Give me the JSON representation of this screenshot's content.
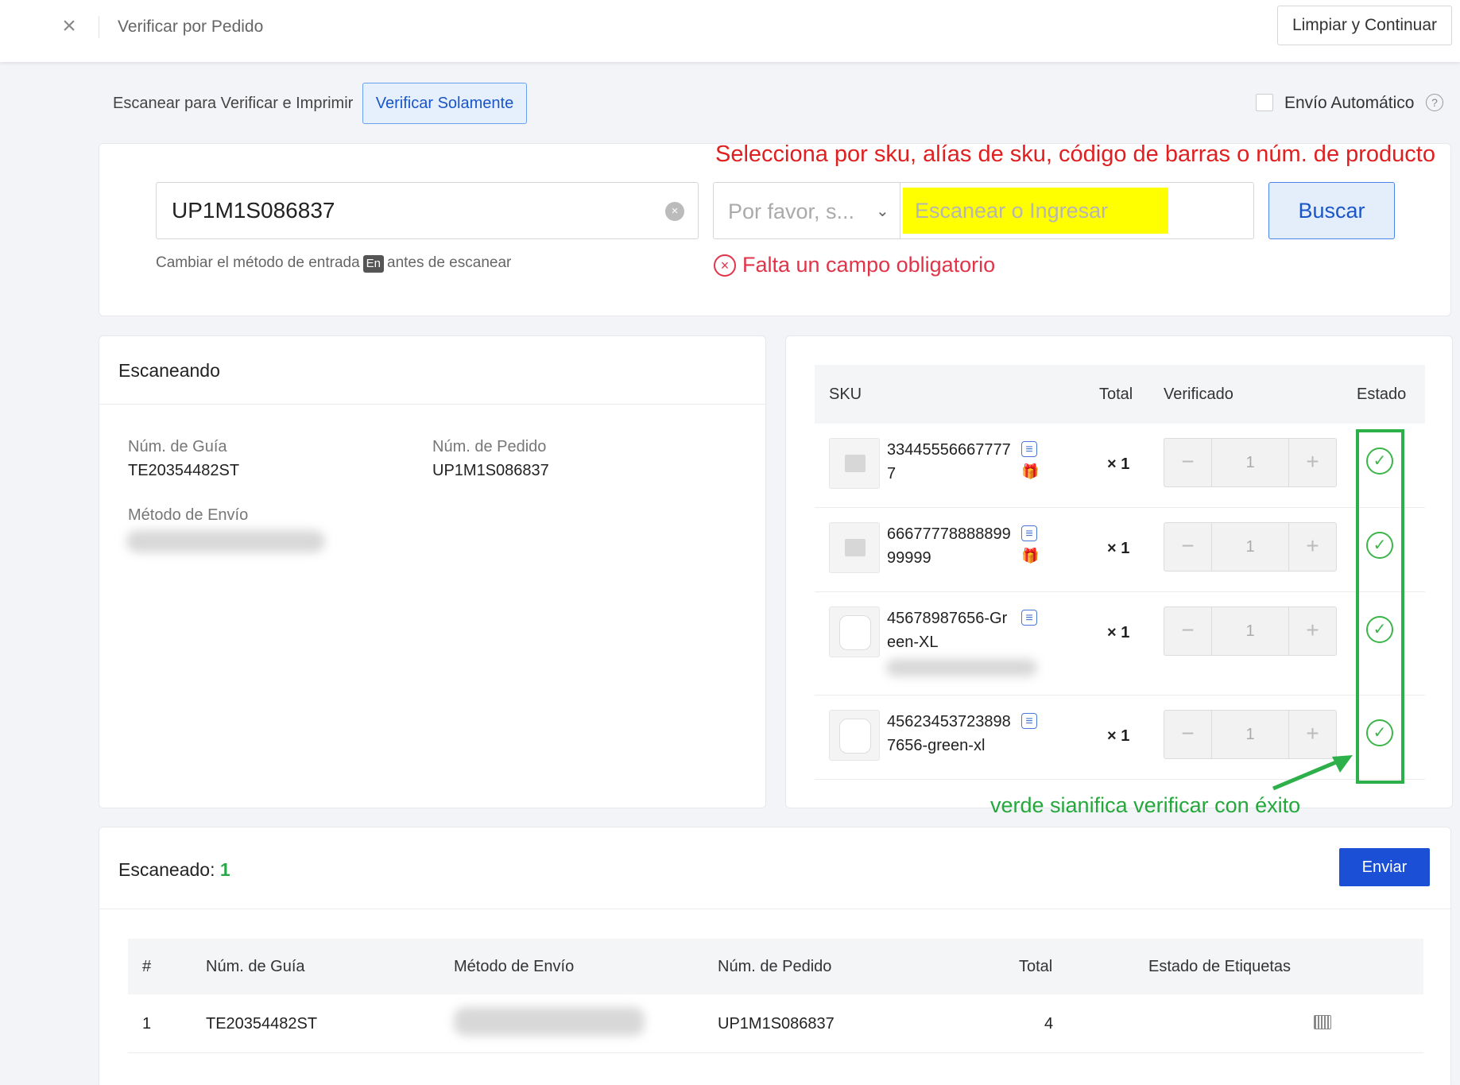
{
  "header": {
    "title": "Verificar por Pedido",
    "clear_button": "Limpiar y Continuar"
  },
  "mode": {
    "scan_print_label": "Escanear para Verificar e Imprimir",
    "verify_only_button": "Verificar Solamente",
    "auto_ship_label": "Envío Automático"
  },
  "search": {
    "annotation": "Selecciona por sku, alías de sku, código de barras o núm. de producto",
    "order_value": "UP1M1S086837",
    "hint_before": "Cambiar el método de entrada",
    "hint_badge": "En",
    "hint_after": "antes de escanear",
    "select_placeholder": "Por favor, s...",
    "scan_placeholder": "Escanear o Ingresar",
    "search_button": "Buscar",
    "error_text": "Falta un campo obligatorio"
  },
  "scanning": {
    "title": "Escaneando",
    "guide_label": "Núm. de Guía",
    "guide_value": "TE20354482ST",
    "order_label": "Núm. de Pedido",
    "order_value": "UP1M1S086837",
    "shipping_label": "Método de Envío"
  },
  "sku_table": {
    "headers": {
      "sku": "SKU",
      "total": "Total",
      "verified": "Verificado",
      "status": "Estado"
    },
    "rows": [
      {
        "sku": "334455566677777",
        "qty": "× 1",
        "verified": "1",
        "gift": true,
        "image": "placeholder"
      },
      {
        "sku": "6667777888889999999",
        "qty": "× 1",
        "verified": "1",
        "gift": true,
        "image": "placeholder"
      },
      {
        "sku": "45678987656-Green-XL",
        "qty": "× 1",
        "verified": "1",
        "gift": false,
        "image": "earbuds"
      },
      {
        "sku": "456234537238987656-green-xl",
        "qty": "× 1",
        "verified": "1",
        "gift": false,
        "image": "earbuds"
      }
    ],
    "annotation": "verde sianifica verificar con éxito",
    "status_color": "#2db04a"
  },
  "scanned": {
    "title": "Escaneado:",
    "count": "1",
    "send_button": "Enviar",
    "headers": {
      "index": "#",
      "guide": "Núm. de Guía",
      "shipping": "Método de Envío",
      "order": "Núm. de Pedido",
      "total": "Total",
      "label_status": "Estado de Etiquetas"
    },
    "rows": [
      {
        "index": "1",
        "guide": "TE20354482ST",
        "order": "UP1M1S086837",
        "total": "4"
      }
    ]
  }
}
